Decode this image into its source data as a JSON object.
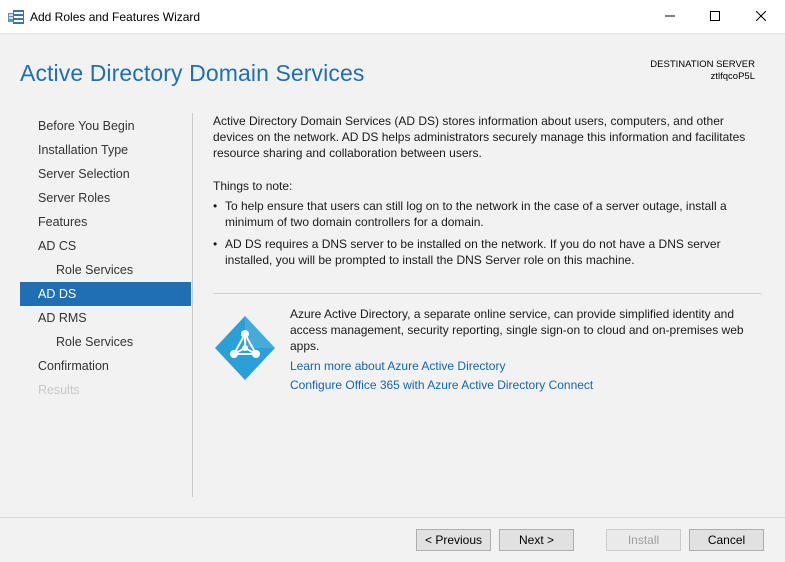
{
  "window": {
    "title": "Add Roles and Features Wizard"
  },
  "header": {
    "title": "Active Directory Domain Services",
    "destination_label": "DESTINATION SERVER",
    "destination_server": "ztlfqcoP5L"
  },
  "nav": {
    "items": [
      {
        "label": "Before You Begin",
        "level": 0,
        "state": "normal"
      },
      {
        "label": "Installation Type",
        "level": 0,
        "state": "normal"
      },
      {
        "label": "Server Selection",
        "level": 0,
        "state": "normal"
      },
      {
        "label": "Server Roles",
        "level": 0,
        "state": "normal"
      },
      {
        "label": "Features",
        "level": 0,
        "state": "normal"
      },
      {
        "label": "AD CS",
        "level": 0,
        "state": "normal"
      },
      {
        "label": "Role Services",
        "level": 1,
        "state": "normal"
      },
      {
        "label": "AD DS",
        "level": 0,
        "state": "active"
      },
      {
        "label": "AD RMS",
        "level": 0,
        "state": "normal"
      },
      {
        "label": "Role Services",
        "level": 1,
        "state": "normal"
      },
      {
        "label": "Confirmation",
        "level": 0,
        "state": "normal"
      },
      {
        "label": "Results",
        "level": 0,
        "state": "disabled"
      }
    ]
  },
  "content": {
    "intro": "Active Directory Domain Services (AD DS) stores information about users, computers, and other devices on the network.  AD DS helps administrators securely manage this information and facilitates resource sharing and collaboration between users.",
    "things_heading": "Things to note:",
    "bullets": [
      "To help ensure that users can still log on to the network in the case of a server outage, install a minimum of two domain controllers for a domain.",
      "AD DS requires a DNS server to be installed on the network.  If you do not have a DNS server installed, you will be prompted to install the DNS Server role on this machine."
    ],
    "azure_text": "Azure Active Directory, a separate online service, can provide simplified identity and access management, security reporting, single sign-on to cloud and on-premises web apps.",
    "link_learn_more": "Learn more about Azure Active Directory",
    "link_configure": "Configure Office 365 with Azure Active Directory Connect"
  },
  "buttons": {
    "previous": "< Previous",
    "next": "Next >",
    "install": "Install",
    "cancel": "Cancel"
  },
  "colors": {
    "accent": "#1f6fb5",
    "title_blue": "#1e6fb3",
    "link": "#1565b0",
    "azure_icon": "#2a9fd8"
  },
  "icons": {
    "app": "server-manager-icon",
    "azure": "azure-active-directory-icon"
  }
}
